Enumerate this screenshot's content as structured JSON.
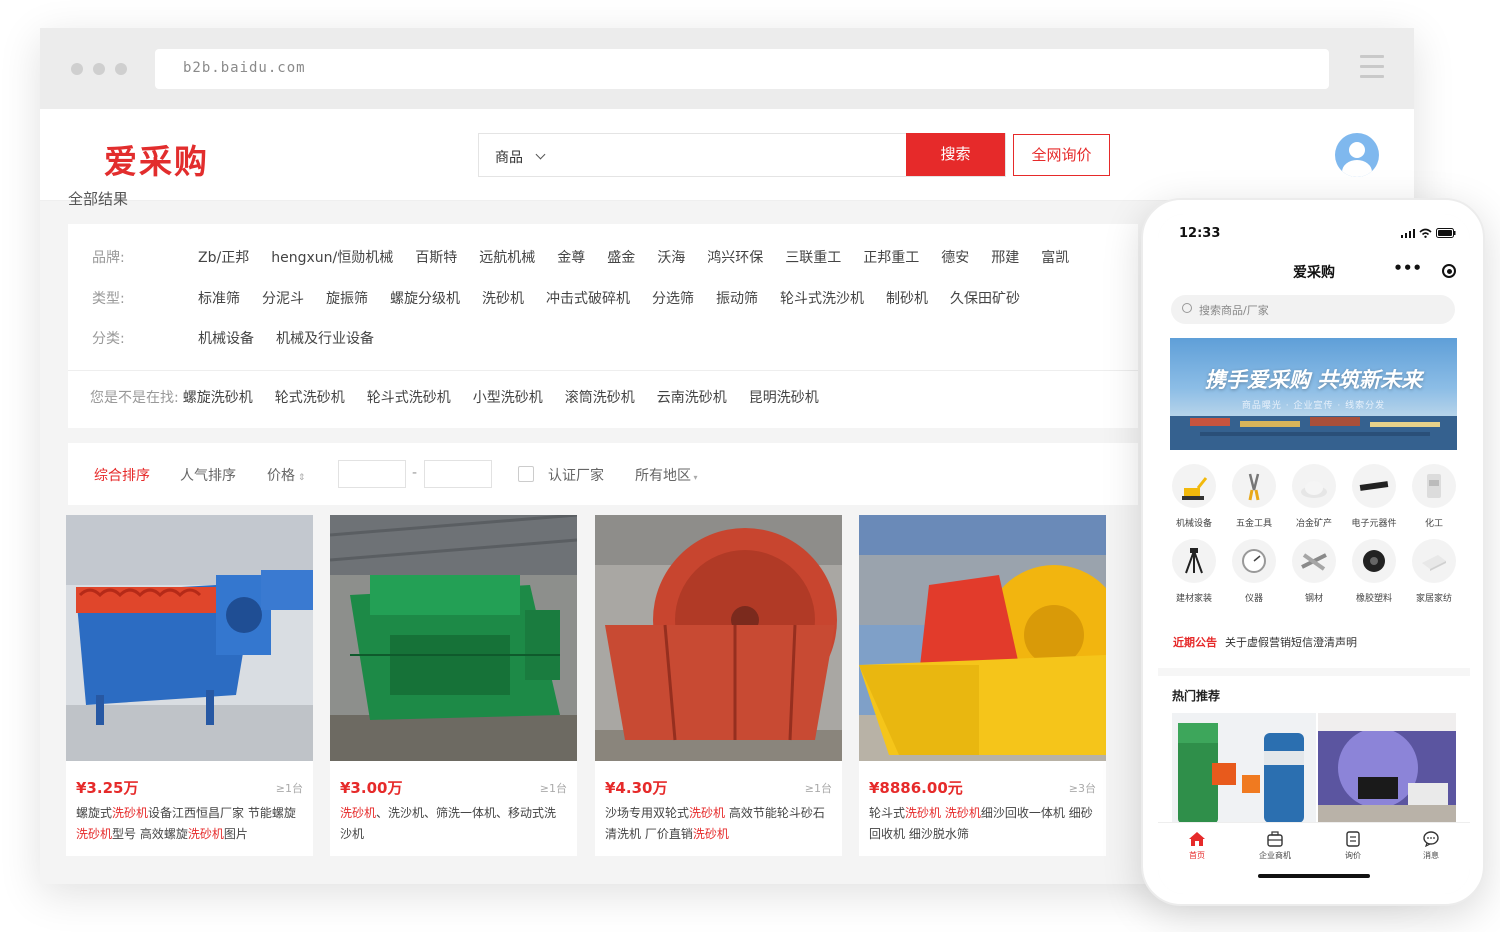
{
  "browser": {
    "url": "b2b.baidu.com"
  },
  "header": {
    "logo": "爱采购",
    "search_scope": "商品",
    "search_button": "搜索",
    "inquiry_button": "全网询价"
  },
  "breadcrumb": "全部结果",
  "filters": {
    "brand_label": "品牌:",
    "brands": [
      "Zb/正邦",
      "hengxun/恒勋机械",
      "百斯特",
      "远航机械",
      "金尊",
      "盛金",
      "沃海",
      "鸿兴环保",
      "三联重工",
      "正邦重工",
      "德安",
      "邢建",
      "富凯"
    ],
    "type_label": "类型:",
    "types": [
      "标准筛",
      "分泥斗",
      "旋振筛",
      "螺旋分级机",
      "洗砂机",
      "冲击式破碎机",
      "分选筛",
      "振动筛",
      "轮斗式洗沙机",
      "制砂机",
      "久保田矿砂"
    ],
    "category_label": "分类:",
    "categories": [
      "机械设备",
      "机械及行业设备"
    ],
    "suggest_label": "您是不是在找:",
    "suggestions": [
      "螺旋洗砂机",
      "轮式洗砂机",
      "轮斗式洗砂机",
      "小型洗砂机",
      "滚筒洗砂机",
      "云南洗砂机",
      "昆明洗砂机"
    ]
  },
  "sortbar": {
    "overall": "综合排序",
    "popularity": "人气排序",
    "price": "价格",
    "price_sep": "-",
    "verified": "认证厂家",
    "region": "所有地区"
  },
  "products": [
    {
      "price": "¥3.25万",
      "moq": "≥1台",
      "title_parts": [
        "螺旋式",
        "洗砂机",
        "设备江西恒昌厂家 节能螺旋",
        "洗砂机",
        "型号 高效螺旋",
        "洗砂机",
        "图片"
      ]
    },
    {
      "price": "¥3.00万",
      "moq": "≥1台",
      "title_parts": [
        "",
        "洗砂机",
        "、洗沙机、筛洗一体机、移动式洗沙机"
      ]
    },
    {
      "price": "¥4.30万",
      "moq": "≥1台",
      "title_parts": [
        "沙场专用双轮式",
        "洗砂机",
        " 高效节能轮斗砂石清洗机 厂价直销",
        "洗砂机"
      ]
    },
    {
      "price": "¥8886.00元",
      "moq": "≥3台",
      "title_parts": [
        "轮斗式",
        "洗砂机",
        " ",
        "洗砂机",
        "细沙回收一体机 细砂回收机 细沙脱水筛"
      ]
    }
  ],
  "phone": {
    "time": "12:33",
    "title": "爱采购",
    "search_placeholder": "搜索商品/厂家",
    "banner_title": "携手爱采购 共筑新未来",
    "banner_sub": "商品曝光 · 企业宣传 · 线索分发",
    "categories": [
      "机械设备",
      "五金工具",
      "冶金矿产",
      "电子元器件",
      "化工",
      "建材家装",
      "仪器",
      "钢材",
      "橡胶塑料",
      "家居家纺"
    ],
    "notice_tag": "近期公告",
    "notice_text": "关于虚假营销短信澄清声明",
    "hot_title": "热门推荐",
    "tabs": [
      "首页",
      "企业商机",
      "询价",
      "消息"
    ]
  },
  "colors": {
    "brand_red": "#e62a2a"
  }
}
